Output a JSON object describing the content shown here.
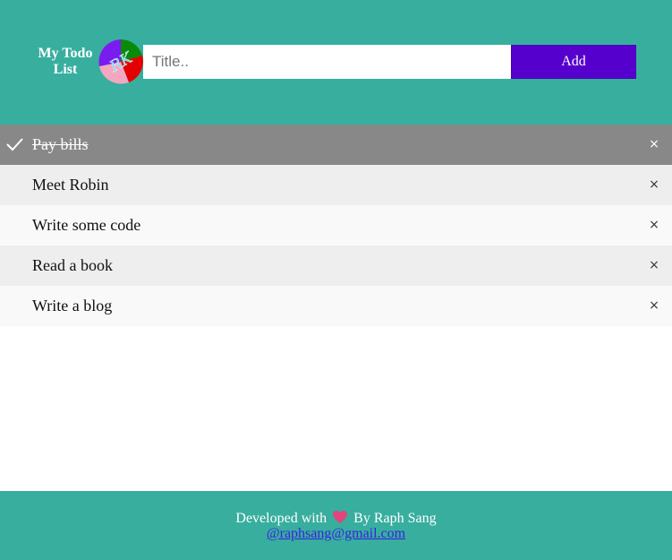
{
  "header": {
    "title": "My Todo List",
    "logo_text": "RK",
    "input": {
      "value": "",
      "placeholder": "Title.."
    },
    "add_label": "Add"
  },
  "todos": [
    {
      "label": "Pay bills",
      "checked": true,
      "close": "×"
    },
    {
      "label": "Meet Robin",
      "checked": false,
      "close": "×"
    },
    {
      "label": "Write some code",
      "checked": false,
      "close": "×"
    },
    {
      "label": "Read a book",
      "checked": false,
      "close": "×"
    },
    {
      "label": "Write a blog",
      "checked": false,
      "close": "×"
    }
  ],
  "footer": {
    "developed_prefix": "Developed with",
    "heart_icon": "heart-icon",
    "developed_suffix": "By Raph Sang",
    "email": "@raphsang@gmail.com"
  },
  "colors": {
    "header_bg": "#38ae9f",
    "add_button": "#5500cc",
    "checked_row": "#888888",
    "row_odd": "#eeeeee",
    "row_even": "#f9f9f9",
    "heart": "#e0457b",
    "link": "#3a1fe0"
  }
}
